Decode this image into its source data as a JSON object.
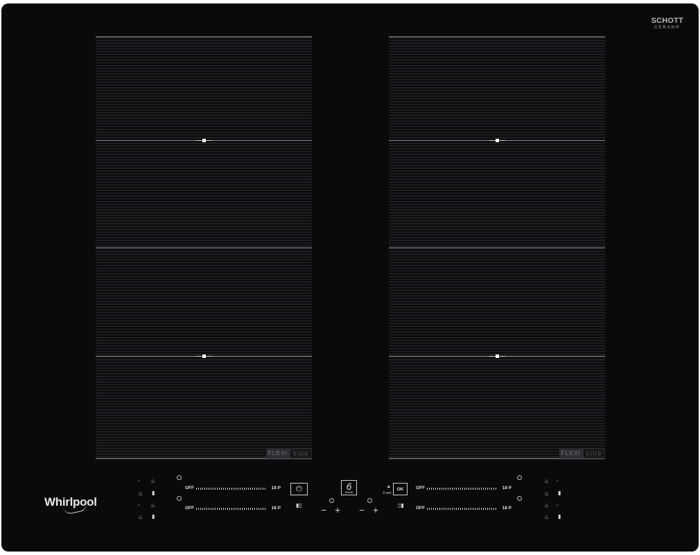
{
  "brand": {
    "top_line1": "SCHOTT",
    "top_line2": "CERAN®",
    "logo": "Whirlpool"
  },
  "zones": {
    "left_label_a": "FLEXI",
    "left_label_b": "SIDE",
    "right_label_a": "FLEXI",
    "right_label_b": "SIDE"
  },
  "sliders": {
    "off_label": "OFF",
    "max_label": "18 P"
  },
  "center": {
    "power_icon": "power-icon",
    "sixth_sense_number": "6",
    "sixth_sense_sub": "SENSE",
    "ok_label": "OK",
    "hold_label": "3 sec",
    "minus": "−",
    "plus": "+"
  },
  "colors": {
    "glass": "#0a0a0c",
    "lines": "#5a5a5e",
    "text": "#e0e0e0"
  }
}
